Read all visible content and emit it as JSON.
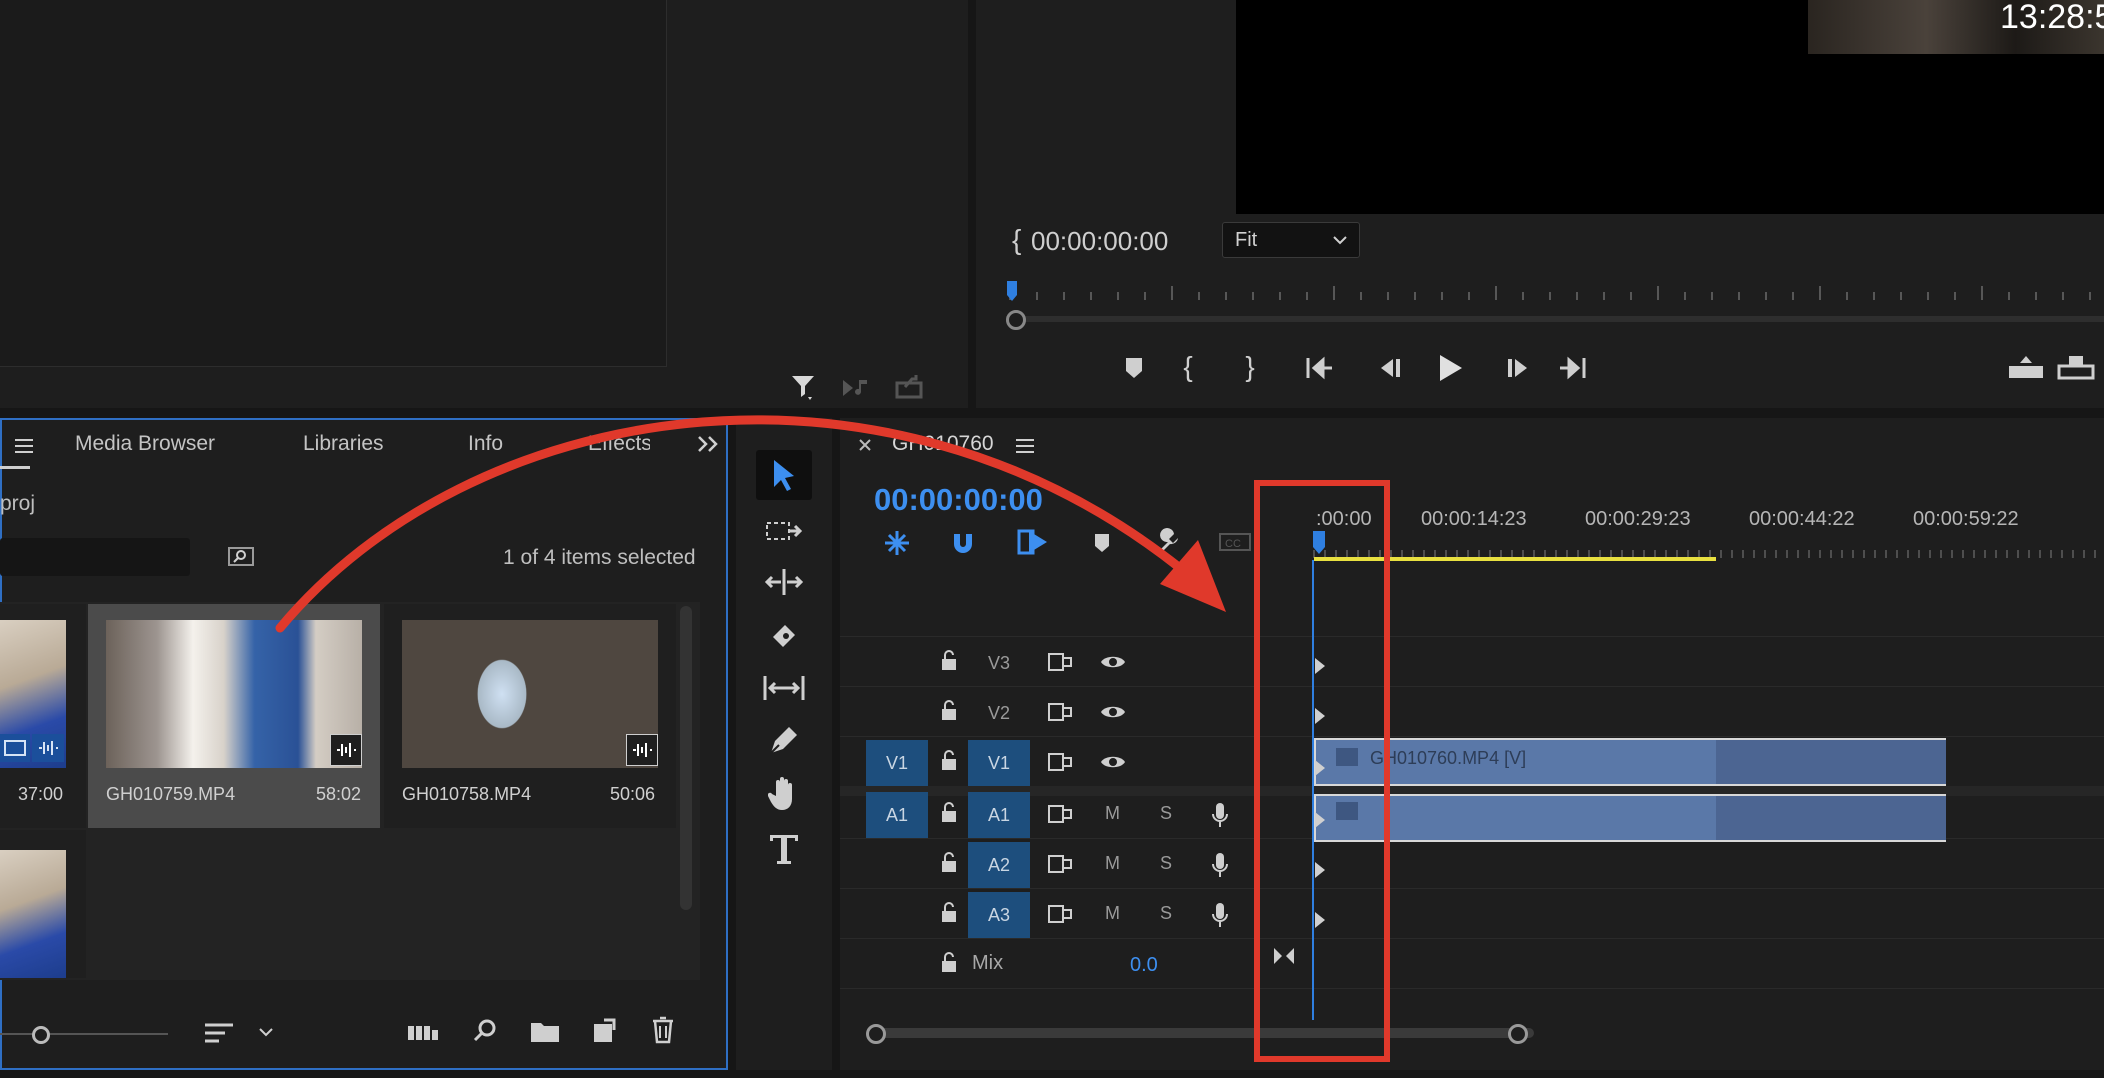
{
  "source_monitor": {},
  "program_monitor": {
    "overlay_time": "13:28:5",
    "in_timecode": "00:00:00:00",
    "zoom": {
      "selected": "Fit"
    }
  },
  "project_panel": {
    "tabs": [
      {
        "label": "Media Browser"
      },
      {
        "label": "Libraries"
      },
      {
        "label": "Info"
      },
      {
        "label": "Effects"
      }
    ],
    "project_name": "proj",
    "selection_status": "1 of 4 items selected",
    "clips": [
      {
        "name": "",
        "duration": "37:00"
      },
      {
        "name": "GH010759.MP4",
        "duration": "58:02"
      },
      {
        "name": "GH010758.MP4",
        "duration": "50:06"
      }
    ]
  },
  "timeline": {
    "sequence_name": "GH010760",
    "playhead_timecode": "00:00:00:00",
    "ruler_labels": [
      ":00:00",
      "00:00:14:23",
      "00:00:29:23",
      "00:00:44:22",
      "00:00:59:22"
    ],
    "tracks": {
      "video": [
        {
          "name": "V3",
          "source": ""
        },
        {
          "name": "V2",
          "source": ""
        },
        {
          "name": "V1",
          "source": "V1"
        }
      ],
      "audio": [
        {
          "name": "A1",
          "source": "A1",
          "mute": "M",
          "solo": "S"
        },
        {
          "name": "A2",
          "source": "",
          "mute": "M",
          "solo": "S"
        },
        {
          "name": "A3",
          "source": "",
          "mute": "M",
          "solo": "S"
        }
      ],
      "mix_label": "Mix",
      "mix_value": "0.0"
    },
    "clip_label": "GH010760.MP4 [V]"
  },
  "annotation": {
    "highlight_color": "#e0392b",
    "arrow_color": "#e0392b"
  }
}
